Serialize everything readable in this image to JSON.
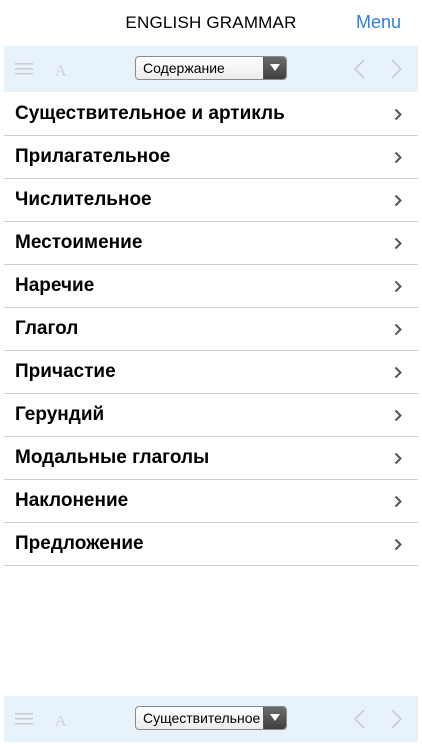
{
  "header": {
    "title": "ENGLISH GRAMMAR",
    "menu_label": "Menu"
  },
  "toolbar_top": {
    "select_value": "Содержание",
    "icons": [
      "list-icon",
      "font-size-icon",
      "back-arrow-icon",
      "forward-arrow-icon"
    ]
  },
  "contents": {
    "items": [
      {
        "label": "Существительное и артикль"
      },
      {
        "label": "Прилагательное"
      },
      {
        "label": "Числительное"
      },
      {
        "label": "Местоимение"
      },
      {
        "label": "Наречие"
      },
      {
        "label": "Глагол"
      },
      {
        "label": "Причастие"
      },
      {
        "label": "Герундий"
      },
      {
        "label": "Модальные глаголы"
      },
      {
        "label": "Наклонение"
      },
      {
        "label": "Предложение"
      }
    ]
  },
  "toolbar_bottom": {
    "select_value": "Существительное",
    "icons": [
      "list-icon",
      "font-size-icon",
      "back-arrow-icon",
      "forward-arrow-icon"
    ]
  },
  "colors": {
    "accent": "#2f7fd6",
    "toolbar_bg": "#e7f2fb",
    "separator": "#cfcfcf"
  }
}
